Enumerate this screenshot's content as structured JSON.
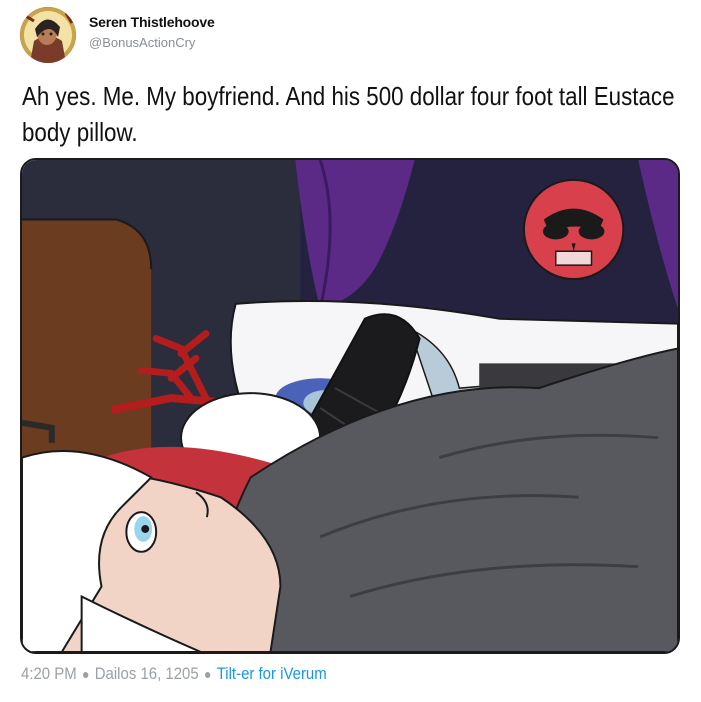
{
  "author": {
    "display_name": "Seren Thistlehoove",
    "handle": "@BonusActionCry"
  },
  "tweet": {
    "text": "Ah yes. Me. My boyfriend. And his 500 dollar four foot tall Eustace body pillow."
  },
  "meta": {
    "time": "4:20 PM",
    "date": "Dailos 16, 1205",
    "source": "Tilt-er for iVerum"
  },
  "colors": {
    "source_link": "#1b95e0",
    "meta_text": "#9aa0a6"
  }
}
